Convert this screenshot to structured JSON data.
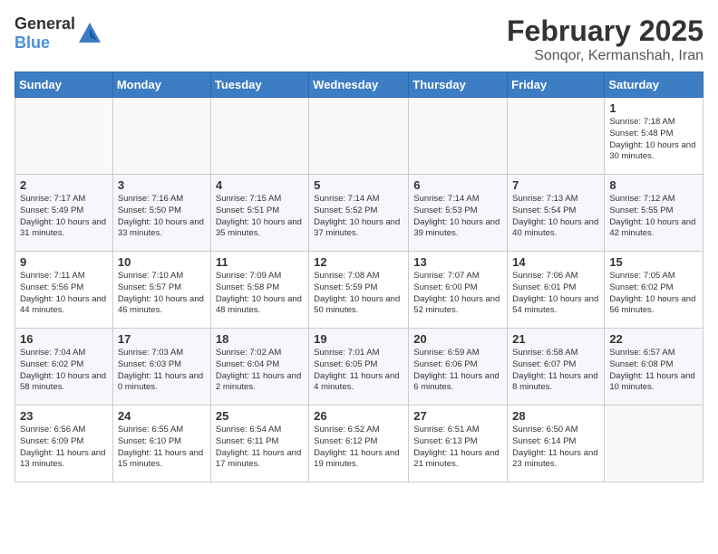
{
  "header": {
    "logo_general": "General",
    "logo_blue": "Blue",
    "month": "February 2025",
    "location": "Sonqor, Kermanshah, Iran"
  },
  "weekdays": [
    "Sunday",
    "Monday",
    "Tuesday",
    "Wednesday",
    "Thursday",
    "Friday",
    "Saturday"
  ],
  "weeks": [
    [
      {
        "day": "",
        "info": ""
      },
      {
        "day": "",
        "info": ""
      },
      {
        "day": "",
        "info": ""
      },
      {
        "day": "",
        "info": ""
      },
      {
        "day": "",
        "info": ""
      },
      {
        "day": "",
        "info": ""
      },
      {
        "day": "1",
        "info": "Sunrise: 7:18 AM\nSunset: 5:48 PM\nDaylight: 10 hours and 30 minutes."
      }
    ],
    [
      {
        "day": "2",
        "info": "Sunrise: 7:17 AM\nSunset: 5:49 PM\nDaylight: 10 hours and 31 minutes."
      },
      {
        "day": "3",
        "info": "Sunrise: 7:16 AM\nSunset: 5:50 PM\nDaylight: 10 hours and 33 minutes."
      },
      {
        "day": "4",
        "info": "Sunrise: 7:15 AM\nSunset: 5:51 PM\nDaylight: 10 hours and 35 minutes."
      },
      {
        "day": "5",
        "info": "Sunrise: 7:14 AM\nSunset: 5:52 PM\nDaylight: 10 hours and 37 minutes."
      },
      {
        "day": "6",
        "info": "Sunrise: 7:14 AM\nSunset: 5:53 PM\nDaylight: 10 hours and 39 minutes."
      },
      {
        "day": "7",
        "info": "Sunrise: 7:13 AM\nSunset: 5:54 PM\nDaylight: 10 hours and 40 minutes."
      },
      {
        "day": "8",
        "info": "Sunrise: 7:12 AM\nSunset: 5:55 PM\nDaylight: 10 hours and 42 minutes."
      }
    ],
    [
      {
        "day": "9",
        "info": "Sunrise: 7:11 AM\nSunset: 5:56 PM\nDaylight: 10 hours and 44 minutes."
      },
      {
        "day": "10",
        "info": "Sunrise: 7:10 AM\nSunset: 5:57 PM\nDaylight: 10 hours and 46 minutes."
      },
      {
        "day": "11",
        "info": "Sunrise: 7:09 AM\nSunset: 5:58 PM\nDaylight: 10 hours and 48 minutes."
      },
      {
        "day": "12",
        "info": "Sunrise: 7:08 AM\nSunset: 5:59 PM\nDaylight: 10 hours and 50 minutes."
      },
      {
        "day": "13",
        "info": "Sunrise: 7:07 AM\nSunset: 6:00 PM\nDaylight: 10 hours and 52 minutes."
      },
      {
        "day": "14",
        "info": "Sunrise: 7:06 AM\nSunset: 6:01 PM\nDaylight: 10 hours and 54 minutes."
      },
      {
        "day": "15",
        "info": "Sunrise: 7:05 AM\nSunset: 6:02 PM\nDaylight: 10 hours and 56 minutes."
      }
    ],
    [
      {
        "day": "16",
        "info": "Sunrise: 7:04 AM\nSunset: 6:02 PM\nDaylight: 10 hours and 58 minutes."
      },
      {
        "day": "17",
        "info": "Sunrise: 7:03 AM\nSunset: 6:03 PM\nDaylight: 11 hours and 0 minutes."
      },
      {
        "day": "18",
        "info": "Sunrise: 7:02 AM\nSunset: 6:04 PM\nDaylight: 11 hours and 2 minutes."
      },
      {
        "day": "19",
        "info": "Sunrise: 7:01 AM\nSunset: 6:05 PM\nDaylight: 11 hours and 4 minutes."
      },
      {
        "day": "20",
        "info": "Sunrise: 6:59 AM\nSunset: 6:06 PM\nDaylight: 11 hours and 6 minutes."
      },
      {
        "day": "21",
        "info": "Sunrise: 6:58 AM\nSunset: 6:07 PM\nDaylight: 11 hours and 8 minutes."
      },
      {
        "day": "22",
        "info": "Sunrise: 6:57 AM\nSunset: 6:08 PM\nDaylight: 11 hours and 10 minutes."
      }
    ],
    [
      {
        "day": "23",
        "info": "Sunrise: 6:56 AM\nSunset: 6:09 PM\nDaylight: 11 hours and 13 minutes."
      },
      {
        "day": "24",
        "info": "Sunrise: 6:55 AM\nSunset: 6:10 PM\nDaylight: 11 hours and 15 minutes."
      },
      {
        "day": "25",
        "info": "Sunrise: 6:54 AM\nSunset: 6:11 PM\nDaylight: 11 hours and 17 minutes."
      },
      {
        "day": "26",
        "info": "Sunrise: 6:52 AM\nSunset: 6:12 PM\nDaylight: 11 hours and 19 minutes."
      },
      {
        "day": "27",
        "info": "Sunrise: 6:51 AM\nSunset: 6:13 PM\nDaylight: 11 hours and 21 minutes."
      },
      {
        "day": "28",
        "info": "Sunrise: 6:50 AM\nSunset: 6:14 PM\nDaylight: 11 hours and 23 minutes."
      },
      {
        "day": "",
        "info": ""
      }
    ]
  ]
}
